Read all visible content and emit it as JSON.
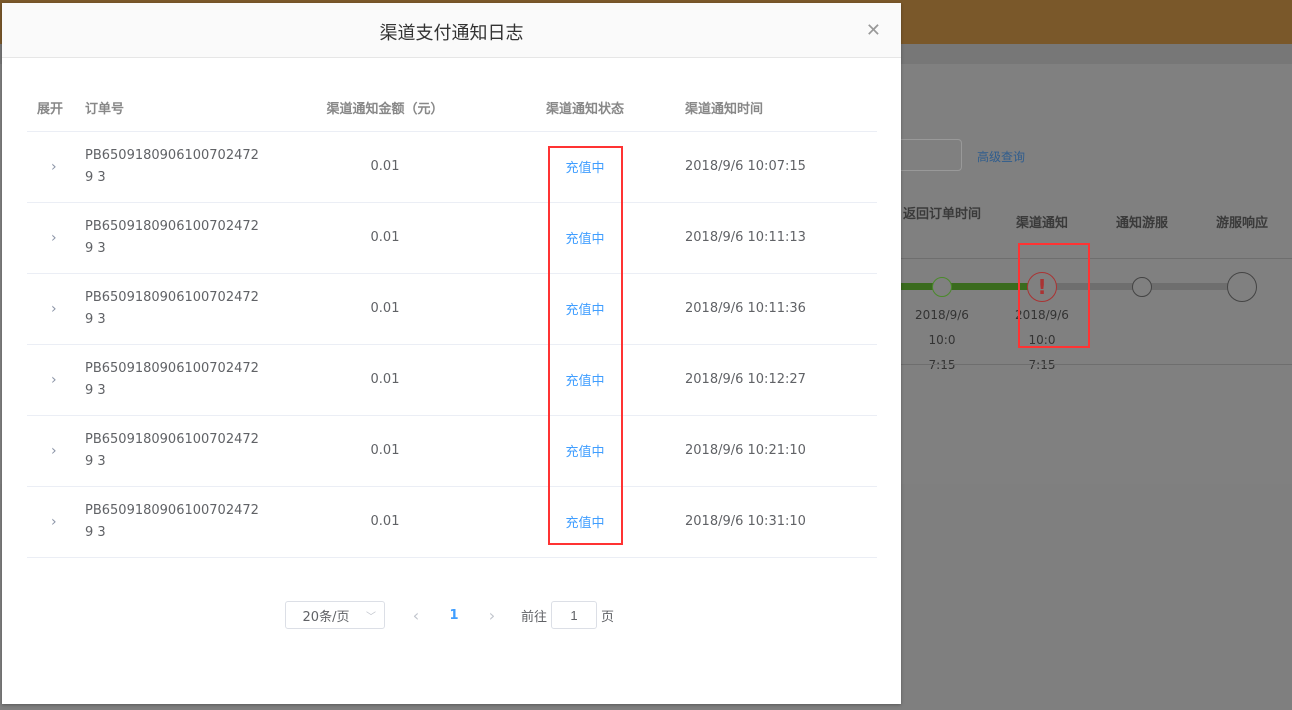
{
  "background": {
    "advanced_query": "高级查询",
    "columns": [
      "返回订单时间",
      "渠道通知",
      "通知游服",
      "游服响应"
    ],
    "times": [
      {
        "line1": "2018/9/6 10:0",
        "line2": "7:15"
      },
      {
        "line1": "2018/9/6 10:0",
        "line2": "7:15"
      }
    ],
    "progress_colors": {
      "done": "#3a6b1e",
      "pending": "#6e6e6e",
      "error": "#a33"
    }
  },
  "modal": {
    "title": "渠道支付通知日志",
    "close_icon": "close-icon",
    "columns": [
      "展开",
      "订单号",
      "渠道通知金额（元）",
      "渠道通知状态",
      "渠道通知时间"
    ],
    "rows": [
      {
        "order": "PB65091809061007024729 3",
        "amount": "0.01",
        "status": "充值中",
        "time": "2018/9/6 10:07:15"
      },
      {
        "order": "PB65091809061007024729 3",
        "amount": "0.01",
        "status": "充值中",
        "time": "2018/9/6 10:11:13"
      },
      {
        "order": "PB65091809061007024729 3",
        "amount": "0.01",
        "status": "充值中",
        "time": "2018/9/6 10:11:36"
      },
      {
        "order": "PB65091809061007024729 3",
        "amount": "0.01",
        "status": "充值中",
        "time": "2018/9/6 10:12:27"
      },
      {
        "order": "PB65091809061007024729 3",
        "amount": "0.01",
        "status": "充值中",
        "time": "2018/9/6 10:21:10"
      },
      {
        "order": "PB65091809061007024729 3",
        "amount": "0.01",
        "status": "充值中",
        "time": "2018/9/6 10:31:10"
      }
    ],
    "pagination": {
      "page_size": "20条/页",
      "current_page": "1",
      "goto_label": "前往",
      "goto_value": "1",
      "page_suffix": "页"
    }
  }
}
